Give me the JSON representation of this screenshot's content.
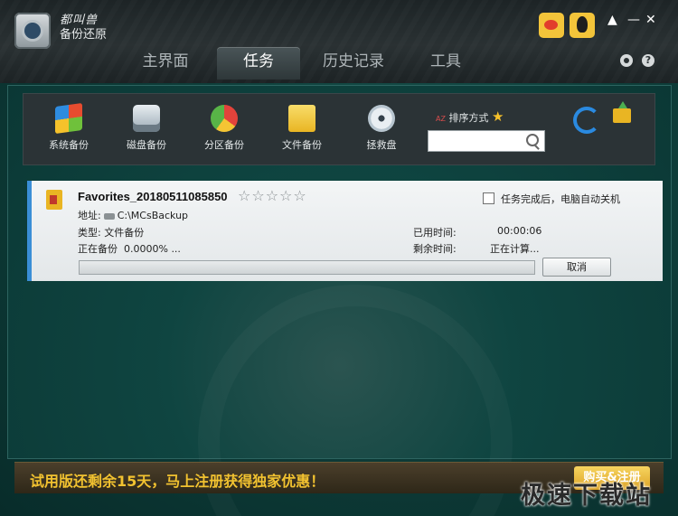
{
  "brand": {
    "line1": "都叫兽",
    "line2": "备份还原"
  },
  "tabs": [
    {
      "label": "主界面"
    },
    {
      "label": "任务"
    },
    {
      "label": "历史记录"
    },
    {
      "label": "工具"
    }
  ],
  "active_tab": "任务",
  "window_buttons": {
    "minimize": "—",
    "close": "✕",
    "help": "?"
  },
  "toolbar": {
    "items": [
      {
        "label": "系统备份",
        "icon": "windows-icon"
      },
      {
        "label": "磁盘备份",
        "icon": "disk-icon"
      },
      {
        "label": "分区备份",
        "icon": "pie-chart-icon"
      },
      {
        "label": "文件备份",
        "icon": "folder-icon"
      },
      {
        "label": "拯救盘",
        "icon": "cd-icon"
      }
    ],
    "sort_label": "排序方式",
    "sort_icon": "AZ",
    "search_placeholder": ""
  },
  "task": {
    "name": "Favorites_20180511085850",
    "stars": "☆☆☆☆☆",
    "auto_shutdown_label": "任务完成后，电脑自动关机",
    "address_label": "地址:",
    "address_value": "C:\\MCsBackup",
    "type_label": "类型:",
    "type_value": "文件备份",
    "status_label": "正在备份",
    "status_value": "0.0000% ...",
    "elapsed_label": "已用时间:",
    "elapsed_value": "00:00:06",
    "remaining_label": "剩余时间:",
    "remaining_value": "正在计算...",
    "progress": 0,
    "cancel_label": "取消"
  },
  "promo": {
    "text": "试用版还剩余15天，马上注册获得独家优惠！",
    "buy_label": "购买&注册"
  },
  "watermark": "极速下载站",
  "colors": {
    "accent_blue": "#3a8ed6",
    "promo_gold": "#f2c230",
    "background": "#0e3e3a"
  }
}
